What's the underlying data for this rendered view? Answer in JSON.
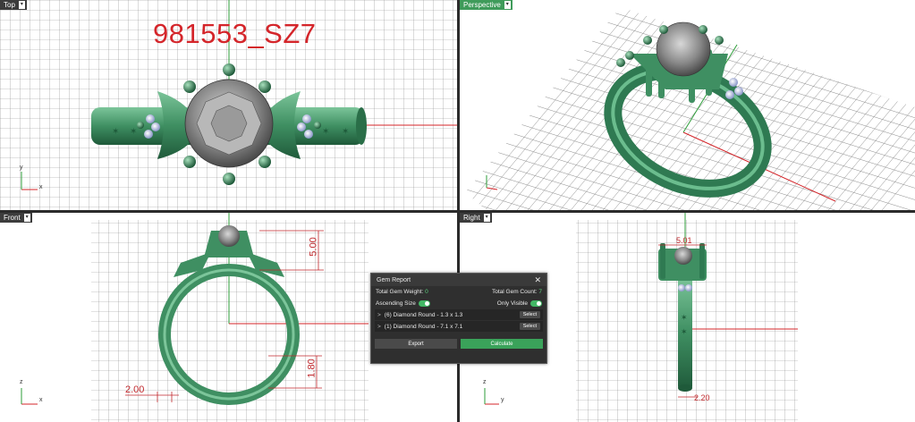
{
  "viewports": {
    "top": {
      "label": "Top"
    },
    "perspective": {
      "label": "Perspective"
    },
    "front": {
      "label": "Front"
    },
    "right": {
      "label": "Right"
    }
  },
  "ring_title": "981553_SZ7",
  "axes": {
    "x": "x",
    "y": "y",
    "z": "z"
  },
  "dimensions": {
    "front_height": "5.00",
    "front_width": "2.00",
    "front_band": "1.80",
    "right_top": "5.01",
    "right_bottom": "2.20"
  },
  "gem_report": {
    "title": "Gem Report",
    "close": "✕",
    "total_weight_label": "Total Gem Weight:",
    "total_weight_value": "0",
    "total_count_label": "Total Gem Count:",
    "total_count_value": "7",
    "ascending_label": "Ascending Size",
    "ascending_on": true,
    "only_visible_label": "Only Visible",
    "only_visible_on": true,
    "items": [
      {
        "chevron": ">",
        "label": "(6) Diamond Round - 1.3 x 1.3",
        "select": "Select"
      },
      {
        "chevron": ">",
        "label": "(1) Diamond Round - 7.1 x 7.1",
        "select": "Select"
      }
    ],
    "export": "Export",
    "calculate": "Calculate"
  },
  "colors": {
    "accent": "#3aa25a",
    "metal": "#3f8f62",
    "dimension": "#c0282c",
    "axis_x": "#d4252a",
    "axis_y": "#2e9e3a"
  }
}
